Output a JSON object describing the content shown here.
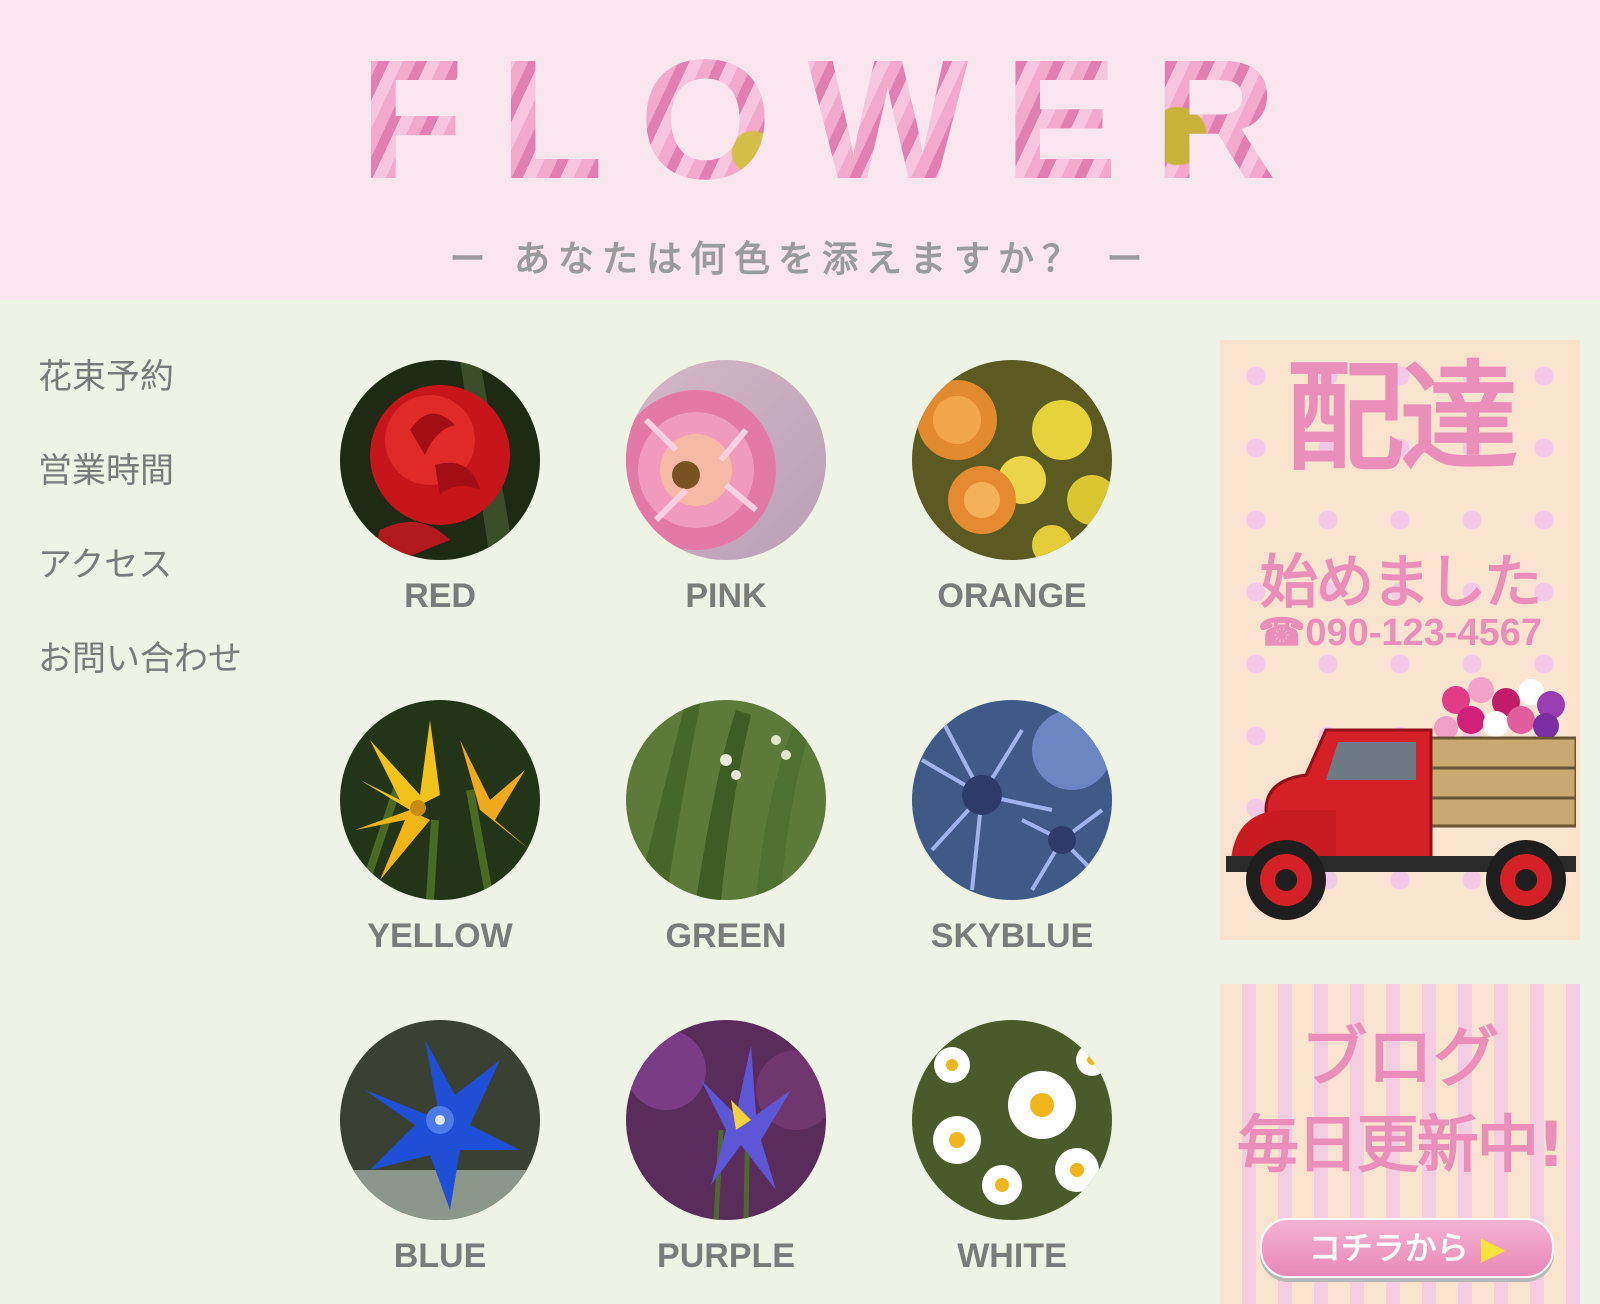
{
  "header": {
    "logo": "FLOWER",
    "tagline": "ー あなたは何色を添えますか？ ー"
  },
  "nav": {
    "items": [
      {
        "label": "花束予約"
      },
      {
        "label": "営業時間"
      },
      {
        "label": "アクセス"
      },
      {
        "label": "お問い合わせ"
      }
    ]
  },
  "colors": [
    {
      "label": "RED"
    },
    {
      "label": "PINK"
    },
    {
      "label": "ORANGE"
    },
    {
      "label": "YELLOW"
    },
    {
      "label": "GREEN"
    },
    {
      "label": "SKYBLUE"
    },
    {
      "label": "BLUE"
    },
    {
      "label": "PURPLE"
    },
    {
      "label": "WHITE"
    }
  ],
  "banners": {
    "delivery": {
      "title": "配達",
      "subtitle": "始めました",
      "phone": "☎090-123-4567"
    },
    "blog": {
      "title": "ブログ",
      "subtitle": "毎日更新中!",
      "button": "コチラから",
      "arrow": "▶"
    }
  }
}
